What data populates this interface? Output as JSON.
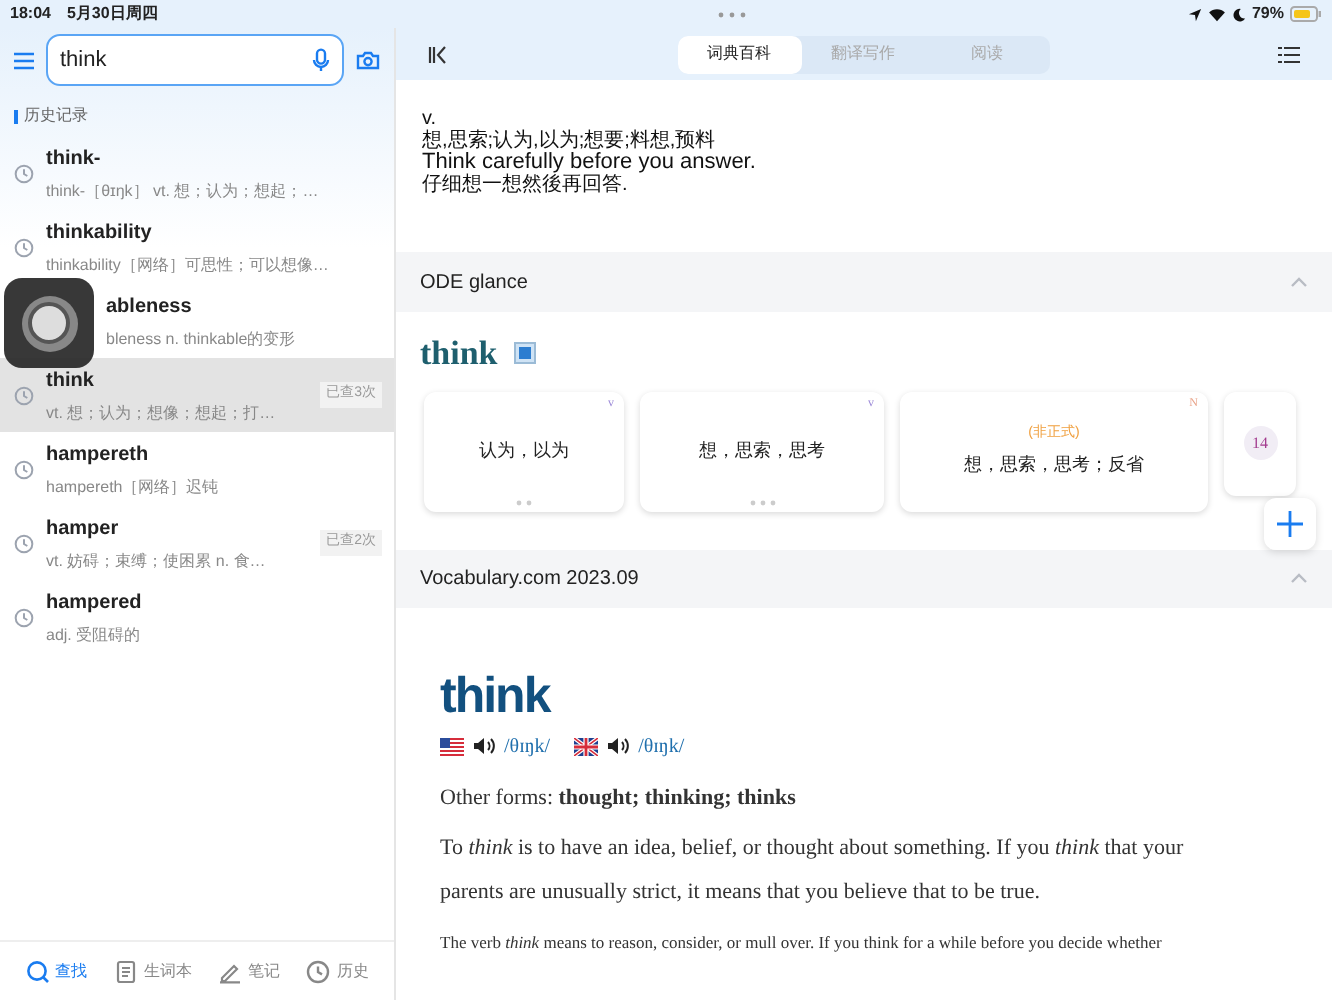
{
  "status_bar": {
    "time": "18:04",
    "date": "5月30日周四",
    "battery": "79%"
  },
  "search": {
    "value": "think"
  },
  "history": {
    "title": "历史记录",
    "items": [
      {
        "word": "think-",
        "summary": "think-［θɪŋk］  vt. 想；认为；想起；…",
        "covered": false,
        "selected": false
      },
      {
        "word": "thinkability",
        "summary": "thinkability［网络］可思性；可以想像…",
        "covered": false,
        "selected": false
      },
      {
        "word": "ableness",
        "summary": "bleness  n. thinkable的变形",
        "covered": true,
        "selected": false
      },
      {
        "word": "think",
        "summary": "vt. 想；认为；想像；想起；打…",
        "badge": "已查3次",
        "covered": false,
        "selected": true
      },
      {
        "word": "hampereth",
        "summary": "hampereth［网络］迟钝",
        "covered": false,
        "selected": false
      },
      {
        "word": "hamper",
        "summary": "vt. 妨碍；束缚；使困累 n. 食…",
        "badge": "已查2次",
        "covered": false,
        "selected": false
      },
      {
        "word": "hampered",
        "summary": "adj. 受阻碍的",
        "covered": false,
        "selected": false
      }
    ]
  },
  "bottom_nav": [
    {
      "label": "查找",
      "kind": "search",
      "selected": true
    },
    {
      "label": "生词本",
      "kind": "notebook",
      "selected": false
    },
    {
      "label": "笔记",
      "kind": "pen",
      "selected": false
    },
    {
      "label": "历史",
      "kind": "clock",
      "selected": false
    }
  ],
  "tabs": [
    {
      "label": "词典百科",
      "selected": true
    },
    {
      "label": "翻译写作",
      "selected": false
    },
    {
      "label": "阅读",
      "selected": false
    }
  ],
  "top_entry": {
    "pos": "v.",
    "meaning": "想,思索;认为,以为;想要;料想,预料",
    "example": "Think carefully before you answer.",
    "translation": "仔细想一想然後再回答."
  },
  "ode": {
    "title": "ODE glance",
    "word": "think",
    "cards": [
      {
        "kind": "sense",
        "tag": "v",
        "meaning": "认为，以为"
      },
      {
        "kind": "sense",
        "tag": "v",
        "meaning": "想，思索，思考"
      },
      {
        "kind": "sense",
        "tag": "N",
        "label": "(非正式)",
        "meaning": "想，思索，思考；反省"
      },
      {
        "kind": "more",
        "count": "14"
      }
    ]
  },
  "vocabulary": {
    "title": "Vocabulary.com 2023.09",
    "word": "think",
    "pronunciations": [
      {
        "kind": "us",
        "ipa": "/θɪŋk/"
      },
      {
        "kind": "uk",
        "ipa": "/θɪŋk/"
      }
    ],
    "other_forms": "Other forms: **thought; thinking; thinks**",
    "short_def": "To *think* is to have an idea, belief, or thought about something. If you *think* that your parents are unusually strict, it means that you believe that to be true.",
    "long_def": "The verb *think* means to reason, consider, or mull over. If you think for a while before you decide whether"
  }
}
